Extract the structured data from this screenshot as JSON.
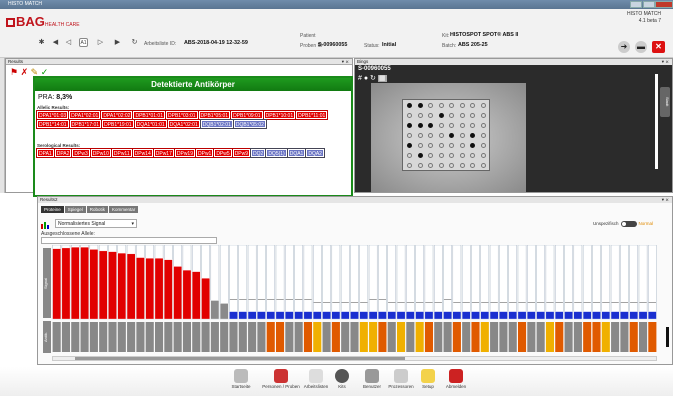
{
  "window": {
    "title": "HISTO MATCH"
  },
  "app": {
    "logo_main": "BAG",
    "logo_sub": "HEALTH CARE",
    "product": "HISTO MATCH",
    "version": "4.1 beta 7"
  },
  "toolbar": {
    "list_label": "Arbeitsliste ID:",
    "list_value": "ABS-2018-04-19 12-32-59",
    "page_label": "A1",
    "patient_label": "Patient",
    "probe_label": "Proben ID",
    "probe_value": "S-00960055",
    "status_label": "Status:",
    "status_value": "Initial",
    "kit_label": "Kit:",
    "kit_value": "HISTOSPOT SPOT® ABS II",
    "batch_label": "Batch:",
    "batch_value": "ABS 205-25"
  },
  "results": {
    "header": "Results",
    "title": "Detektierte Antikörper",
    "pra_label": "PRA:",
    "pra_value": "8,3%",
    "allelic_label": "Allelic Results:",
    "allelic": [
      "DPA1*01:03",
      "DPA1*02:01",
      "DPA1*02:02",
      "DPB1*01:01",
      "DPB1*03:01",
      "DPB1*05:01",
      "DPB1*09:01",
      "DPB1*10:01",
      "DPB1*11:01",
      "DPB1*14:01",
      "DPB1*17:01",
      "DPB1*19:01",
      "DQA1*01:01",
      "DQA1*02:01",
      "DQB1*02:01",
      "DQB1*05:02"
    ],
    "allelic_blue": [
      14,
      15
    ],
    "sero_label": "Serological Results:",
    "sero": [
      "DPA1",
      "DPA2",
      "DPw3",
      "DPw10",
      "DPw11",
      "DPw14",
      "DPw17",
      "DPw19",
      "DPw1",
      "DPw5",
      "DPw9",
      "DQ2",
      "DQ5(1)",
      "DQA1",
      "DQA2"
    ],
    "sero_blue": [
      11,
      12,
      13,
      14
    ]
  },
  "image": {
    "header": "Bings",
    "sample": "S-00960055",
    "slider_label": "Stadt"
  },
  "results2": {
    "header": "Results2",
    "tabs": [
      "Proteine",
      "Spiegel",
      "Robotik",
      "Kommentar"
    ],
    "select_value": "Normalisiertes Signal",
    "excluded_label": "Ausgeschlossene Allele:",
    "toggle_left": "Unspezifisch",
    "toggle_right": "Normal",
    "axis_signal": "Signal",
    "axis_beads": "Antik."
  },
  "chart_data": {
    "type": "bar",
    "values": [
      0.95,
      0.96,
      0.97,
      0.97,
      0.94,
      0.92,
      0.91,
      0.89,
      0.88,
      0.83,
      0.82,
      0.82,
      0.8,
      0.71,
      0.66,
      0.64,
      0.55,
      0.25,
      0.21,
      0.1,
      0.1,
      0.1,
      0.1,
      0.1,
      0.1,
      0.1,
      0.1,
      0.1,
      0.1,
      0.1,
      0.1,
      0.1,
      0.1,
      0.1,
      0.1,
      0.1,
      0.1,
      0.1,
      0.1,
      0.1,
      0.1,
      0.1,
      0.1,
      0.1,
      0.1,
      0.1,
      0.1,
      0.1,
      0.1,
      0.1,
      0.1,
      0.1,
      0.1,
      0.1,
      0.1,
      0.1,
      0.1,
      0.1,
      0.1,
      0.1,
      0.1,
      0.1,
      0.1,
      0.1,
      0.1
    ],
    "colors": [
      "r",
      "r",
      "r",
      "r",
      "r",
      "r",
      "r",
      "r",
      "r",
      "r",
      "r",
      "r",
      "r",
      "r",
      "r",
      "r",
      "r",
      "g",
      "g",
      "b",
      "b",
      "b",
      "b",
      "b",
      "b",
      "b",
      "b",
      "b",
      "b",
      "b",
      "b",
      "b",
      "b",
      "b",
      "b",
      "b",
      "b",
      "b",
      "b",
      "b",
      "b",
      "b",
      "b",
      "b",
      "b",
      "b",
      "b",
      "b",
      "b",
      "b",
      "b",
      "b",
      "b",
      "b",
      "b",
      "b",
      "b",
      "b",
      "b",
      "b",
      "b",
      "b",
      "b",
      "b",
      "b"
    ],
    "thresholds": [
      0,
      0,
      0,
      0,
      0,
      0,
      0,
      0,
      0,
      0,
      0,
      0,
      0,
      0,
      0,
      0,
      0,
      0,
      0,
      0.18,
      0.18,
      0.18,
      0.18,
      0.18,
      0.18,
      0.18,
      0.18,
      0.18,
      0.14,
      0.14,
      0.14,
      0.14,
      0.14,
      0.14,
      0.18,
      0.18,
      0.14,
      0.14,
      0.14,
      0.14,
      0.14,
      0.14,
      0.18,
      0.14,
      0.14,
      0.14,
      0.14,
      0.14,
      0.14,
      0.14,
      0.14,
      0.14,
      0.14,
      0.14,
      0.14,
      0.14,
      0.14,
      0.14,
      0.14,
      0.14,
      0.14,
      0.14,
      0.14,
      0.14,
      0.14
    ],
    "bead_colors": [
      "#888",
      "#888",
      "#888",
      "#888",
      "#888",
      "#888",
      "#888",
      "#888",
      "#888",
      "#888",
      "#888",
      "#888",
      "#888",
      "#888",
      "#888",
      "#888",
      "#888",
      "#888",
      "#888",
      "#888",
      "#888",
      "#888",
      "#888",
      "#e05a00",
      "#e05a00",
      "#888",
      "#888",
      "#e05a00",
      "#f0b000",
      "#888",
      "#e05a00",
      "#888",
      "#888",
      "#f0b000",
      "#f0b000",
      "#e05a00",
      "#888",
      "#f0b000",
      "#888",
      "#f0b000",
      "#e05a00",
      "#888",
      "#888",
      "#e05a00",
      "#888",
      "#e05a00",
      "#f0b000",
      "#888",
      "#888",
      "#888",
      "#e05a00",
      "#888",
      "#888",
      "#f0b000",
      "#e05a00",
      "#888",
      "#888",
      "#e05a00",
      "#e05a00",
      "#f0b000",
      "#888",
      "#888",
      "#e05a00",
      "#888",
      "#e05a00"
    ],
    "accent_red": "#e10000",
    "accent_blue": "#1a2fd0",
    "accent_gray": "#8a8a8a"
  },
  "taskbar": [
    "Startseite",
    "Personen / Proben",
    "Arbeitslisten",
    "Kits",
    "Benutzer",
    "Prozessoren",
    "Setup",
    "Abmelden"
  ]
}
